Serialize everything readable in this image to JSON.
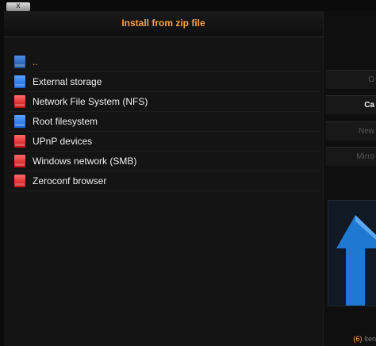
{
  "window": {
    "close_label": "x",
    "title": "Install from zip file"
  },
  "file_list": {
    "parent": {
      "label": "..",
      "icon": "folder-up-icon"
    },
    "items": [
      {
        "label": "External storage",
        "icon": "storage-drive-icon",
        "color": "#1f7cf0"
      },
      {
        "label": "Network File System (NFS)",
        "icon": "network-drive-icon",
        "color": "#e31b1b"
      },
      {
        "label": "Root filesystem",
        "icon": "storage-drive-icon",
        "color": "#1f7cf0"
      },
      {
        "label": "UPnP devices",
        "icon": "network-drive-icon",
        "color": "#e31b1b"
      },
      {
        "label": "Windows network (SMB)",
        "icon": "network-drive-icon",
        "color": "#e31b1b"
      },
      {
        "label": "Zeroconf browser",
        "icon": "network-drive-icon",
        "color": "#e31b1b"
      }
    ]
  },
  "sidebar": {
    "buttons": [
      {
        "label": "O",
        "state": "dim"
      },
      {
        "label": "Ca",
        "state": "bright"
      },
      {
        "label": "New",
        "state": "dim"
      },
      {
        "label": "Mirro",
        "state": "dim"
      }
    ],
    "preview_icon": "folder-up-arrow-icon",
    "items_count": {
      "number": "(6)",
      "label": "Iten"
    }
  },
  "colors": {
    "accent": "#f7a24a",
    "background": "#0b0b0b"
  }
}
